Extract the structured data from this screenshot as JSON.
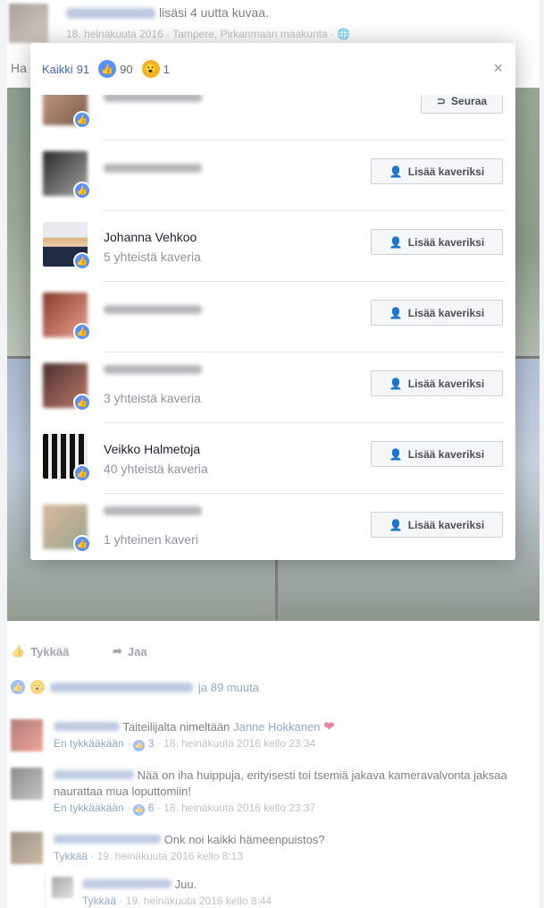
{
  "post": {
    "action_text": "lisäsi 4 uutta kuvaa.",
    "meta": "18. heinäkuuta 2016 · Tampere, Pirkanmaan maakunta ·",
    "text_start": "Ha"
  },
  "actions": {
    "like": "Tykkää",
    "share": "Jaa"
  },
  "reactions_line": {
    "others": "ja 89 muuta"
  },
  "comments": [
    {
      "author_blurred": true,
      "text": "Taiteilijalta nimeltään",
      "mention": "Janne Hokkanen",
      "reply": "En tykkääkään",
      "likes": "3",
      "time": "18. heinäkuuta 2016 kello 23:34"
    },
    {
      "author_blurred": true,
      "text": "Nää on iha huippuja, erityisesti toi tsemiä jakava kameravalvonta jaksaa naurattaa mua loputtomiin!",
      "reply": "En tykkääkään",
      "likes": "6",
      "time": "18. heinäkuuta 2016 kello 23:37"
    },
    {
      "author_blurred": true,
      "text": "Onk noi kaikki hämeenpuistos?",
      "reply": "Tykkää",
      "time": "19. heinäkuuta 2016 kello 8:13"
    },
    {
      "author_blurred": true,
      "text": "Juu.",
      "reply": "Tykkää",
      "time": "19. heinäkuuta 2016 kello 8:44"
    }
  ],
  "modal": {
    "tab_all_label": "Kaikki",
    "tab_all_count": "91",
    "tab_like_count": "90",
    "tab_wow_count": "1",
    "close": "×",
    "follow_label": "Seuraa",
    "add_friend_label": "Lisää kaveriksi",
    "people": [
      {
        "name": "",
        "mutual": "",
        "button": "follow"
      },
      {
        "name": "",
        "mutual": "",
        "button": "add"
      },
      {
        "name": "Johanna Vehkoo",
        "mutual": "5 yhteistä kaveria",
        "button": "add"
      },
      {
        "name": "",
        "mutual": "",
        "button": "add"
      },
      {
        "name": "",
        "mutual": "3 yhteistä kaveria",
        "button": "add"
      },
      {
        "name": "Veikko Halmetoja",
        "mutual": "40 yhteistä kaveria",
        "button": "add"
      },
      {
        "name": "",
        "mutual": "1 yhteinen kaveri",
        "button": "add"
      }
    ]
  },
  "colors": {
    "accent": "#4267b2",
    "like_blue": "#5890ff",
    "wow_yellow": "#f7b125",
    "heart": "#e0245e"
  }
}
